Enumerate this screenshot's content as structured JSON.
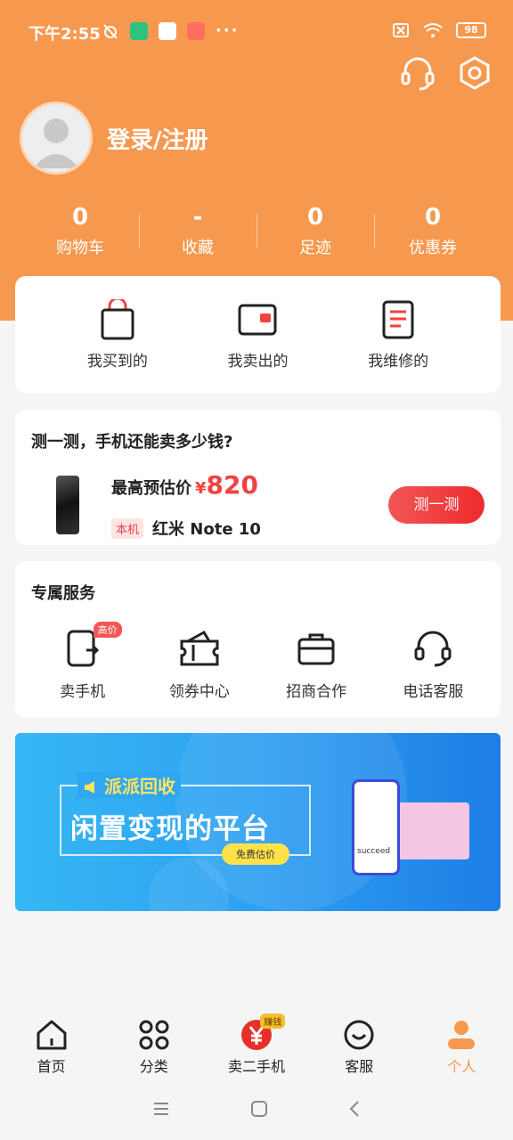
{
  "status_bar": {
    "time": "下午2:55",
    "more": "···",
    "battery": "98"
  },
  "header": {
    "login_label": "登录/注册"
  },
  "stats": [
    {
      "value": "0",
      "label": "购物车"
    },
    {
      "value": "-",
      "label": "收藏"
    },
    {
      "value": "0",
      "label": "足迹"
    },
    {
      "value": "0",
      "label": "优惠券"
    }
  ],
  "orders": [
    {
      "label": "我买到的",
      "icon": "shopping-bag-icon"
    },
    {
      "label": "我卖出的",
      "icon": "wallet-icon"
    },
    {
      "label": "我维修的",
      "icon": "repair-list-icon"
    }
  ],
  "estimate": {
    "title": "测一测，手机还能卖多少钱?",
    "price_label": "最高预估价",
    "currency": "¥",
    "price": "820",
    "tag": "本机",
    "model": "红米 Note 10",
    "button": "测一测"
  },
  "services": {
    "title": "专属服务",
    "badge": "高价",
    "items": [
      {
        "label": "卖手机",
        "icon": "sell-phone-icon"
      },
      {
        "label": "领券中心",
        "icon": "coupon-icon"
      },
      {
        "label": "招商合作",
        "icon": "briefcase-icon"
      },
      {
        "label": "电话客服",
        "icon": "headset-icon"
      }
    ]
  },
  "banner": {
    "small_title": "派派回收",
    "big_title": "闲置变现的平台",
    "button": "免费估价",
    "phone_text": "succeed"
  },
  "bottom_nav": [
    {
      "label": "首页",
      "icon": "home-icon"
    },
    {
      "label": "分类",
      "icon": "category-icon"
    },
    {
      "label": "卖二手机",
      "icon": "yen-icon",
      "badge": "赚钱"
    },
    {
      "label": "客服",
      "icon": "smile-icon"
    },
    {
      "label": "个人",
      "icon": "person-icon",
      "active": true
    }
  ],
  "colors": {
    "primary": "#f7984f",
    "accent_red": "#f24141",
    "banner_blue": "#2ea0f1"
  }
}
